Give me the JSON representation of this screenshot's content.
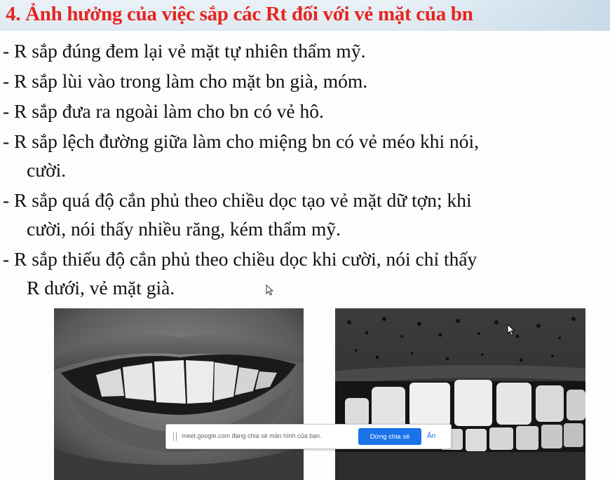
{
  "slide": {
    "title": "4. Ảnh hưởng của việc sắp các Rt đối với vẻ mặt của bn",
    "bullets": [
      {
        "lines": [
          "- R sắp đúng đem lại vẻ mặt tự nhiên thẩm mỹ."
        ]
      },
      {
        "lines": [
          "- R sắp lùi vào trong làm cho mặt bn già, móm."
        ]
      },
      {
        "lines": [
          "- R sắp đưa ra ngoài làm cho bn có vẻ hô."
        ]
      },
      {
        "lines": [
          "- R sắp lệch đường giữa làm cho miệng bn có vẻ méo khi nói,",
          "cười."
        ]
      },
      {
        "lines": [
          "- R sắp quá độ cắn phủ theo chiều dọc tạo vẻ mặt dữ tợn; khi",
          "cười, nói thấy nhiều răng, kém thẩm mỹ."
        ]
      },
      {
        "lines": [
          "- R sắp thiếu độ cắn phủ theo chiều dọc khi cười, nói chỉ thấy",
          "R dưới, vẻ mặt già."
        ]
      }
    ],
    "title_color": "#e5251f"
  },
  "share_bar": {
    "message": "meet.google.com đang chia sẻ màn hình của bạn.",
    "stop_label": "Dừng chia sẻ",
    "hide_label": "Ẩn",
    "accent": "#1a73e8"
  },
  "icons": {
    "cursor": "mouse-pointer-icon",
    "grip": "drag-handle-icon"
  }
}
